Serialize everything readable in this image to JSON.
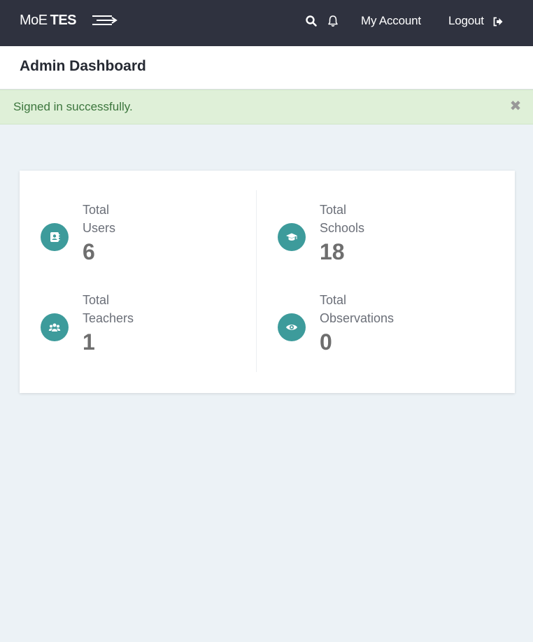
{
  "navbar": {
    "brand_light": "MoE",
    "brand_bold": "TES",
    "account_label": "My Account",
    "logout_label": "Logout",
    "icons": [
      "menu-toggle-icon",
      "search-icon",
      "bell-icon",
      "logout-icon"
    ]
  },
  "page": {
    "title": "Admin Dashboard"
  },
  "alert": {
    "message": "Signed in successfully.",
    "close_glyph": "✖"
  },
  "stats": [
    {
      "label1": "Total",
      "label2": "Users",
      "value": "6",
      "icon": "address-book-icon"
    },
    {
      "label1": "Total",
      "label2": "Schools",
      "value": "18",
      "icon": "graduation-cap-icon"
    },
    {
      "label1": "Total",
      "label2": "Teachers",
      "value": "1",
      "icon": "users-group-icon"
    },
    {
      "label1": "Total",
      "label2": "Observations",
      "value": "0",
      "icon": "eye-icon"
    }
  ],
  "colors": {
    "navbar_bg": "#2f323f",
    "accent_teal": "#3d9b9b",
    "alert_bg": "#dff0d8",
    "alert_text": "#3c763d",
    "page_bg": "#ecf2f6"
  }
}
